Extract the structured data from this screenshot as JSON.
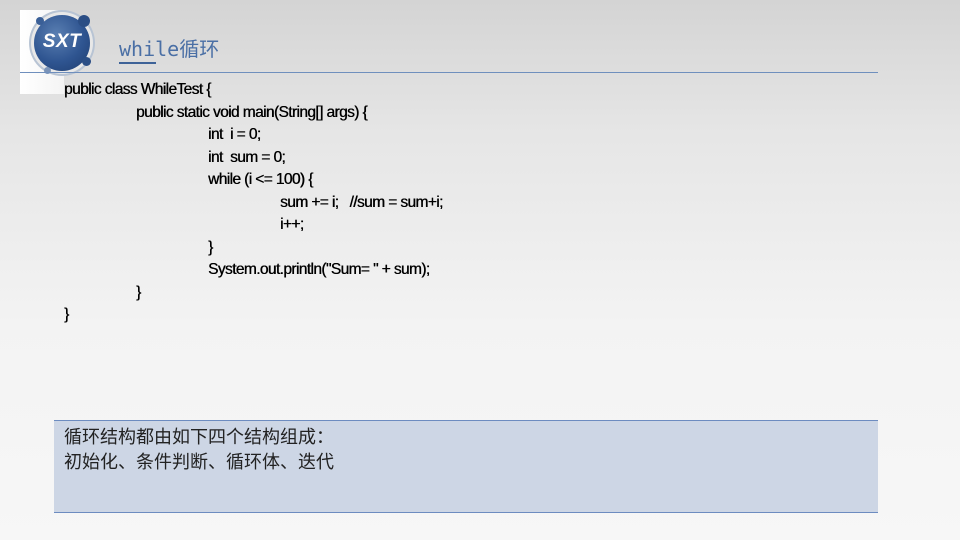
{
  "header": {
    "logo_text": "SXT",
    "title": "while循环"
  },
  "code": {
    "lines": [
      {
        "indent": 0,
        "text": "public class WhileTest {"
      },
      {
        "indent": 1,
        "text": "public static void main(String[] args) {"
      },
      {
        "indent": 2,
        "text": "int  i = 0;"
      },
      {
        "indent": 2,
        "text": "int  sum = 0;"
      },
      {
        "indent": 2,
        "text": "while (i <= 100) {"
      },
      {
        "indent": 3,
        "text": "sum += i;   //sum = sum+i;"
      },
      {
        "indent": 3,
        "text": "i++;"
      },
      {
        "indent": 2,
        "text": "}"
      },
      {
        "indent": 2,
        "text": "System.out.println(\"Sum= \" + sum);"
      },
      {
        "indent": 1,
        "text": "}"
      },
      {
        "indent": 0,
        "text": "}"
      }
    ]
  },
  "summary": {
    "line1": "循环结构都由如下四个结构组成：",
    "line2": "初始化、条件判断、循环体、迭代"
  },
  "colors": {
    "title": "#4a6fa5",
    "rule": "#6f8fbd",
    "box_fill": "#cdd6e5",
    "box_border": "#6d8cc0",
    "logo": "#2f5591"
  }
}
